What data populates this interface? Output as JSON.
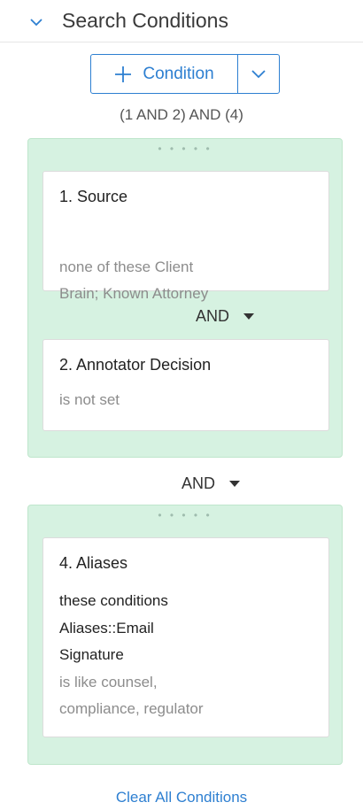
{
  "header": {
    "title": "Search Conditions"
  },
  "add_button": {
    "label": "Condition"
  },
  "logic_expression": "(1 AND 2) AND (4)",
  "groups": [
    {
      "handle": "• • • • •",
      "conditions": [
        {
          "title": "1. Source",
          "lines": [
            "none of these Client",
            "Brain; Known Attorney"
          ]
        },
        {
          "title": "2. Annotator Decision",
          "lines": [
            "is not set"
          ]
        }
      ],
      "operator": "AND"
    },
    {
      "handle": "• • • • •",
      "conditions": [
        {
          "title": "4. Aliases",
          "lines": [
            "these conditions",
            "Aliases::Email",
            "Signature",
            "is like counsel,",
            "compliance, regulator"
          ]
        }
      ]
    }
  ],
  "between_groups_operator": "AND",
  "footer": {
    "clear_label": "Clear All Conditions"
  },
  "colors": {
    "accent": "#2d7fd1",
    "group_bg": "#d6f2e1"
  }
}
